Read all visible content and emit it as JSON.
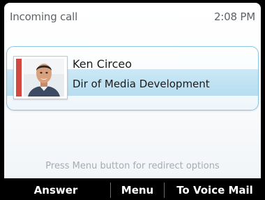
{
  "header": {
    "title": "Incoming call",
    "time": "2:08 PM"
  },
  "contact": {
    "name": "Ken Circeo",
    "job_title": "Dir of Media Development",
    "presence_color": "#d2473e"
  },
  "hint": "Press Menu button for redirect options",
  "softkeys": {
    "answer": "Answer",
    "menu": "Menu",
    "voicemail": "To Voice Mail"
  }
}
